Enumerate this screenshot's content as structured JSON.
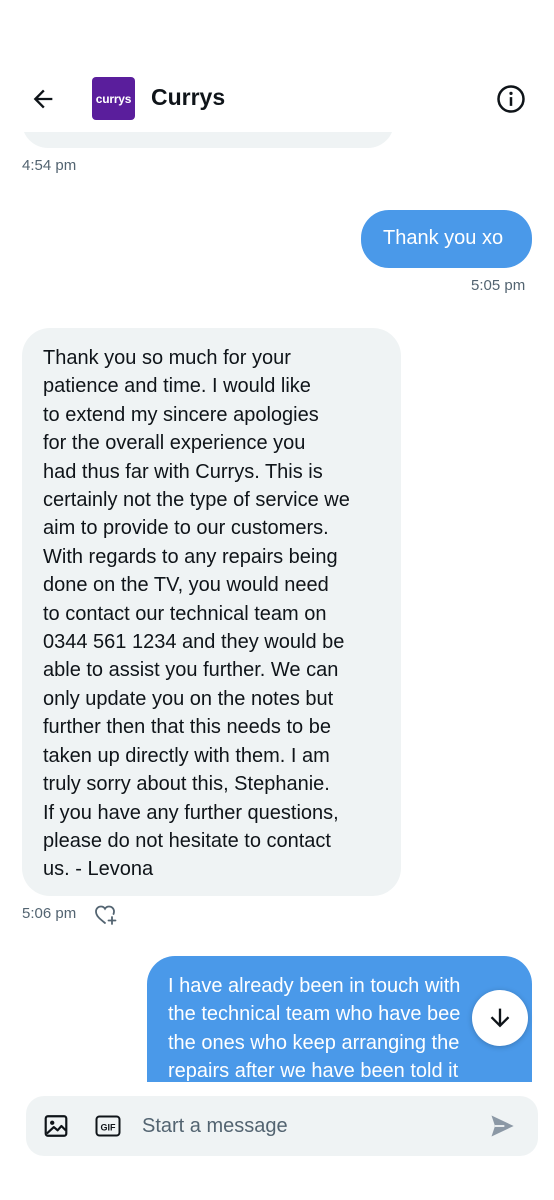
{
  "header": {
    "back_icon": "arrow-left-icon",
    "logo_text": "currys",
    "contact_name": "Currys",
    "info_icon": "info-icon",
    "brand_color": "#5a1e9c"
  },
  "messages": [
    {
      "id": "prev",
      "timestamp": "4:54 pm"
    },
    {
      "id": "m1",
      "direction": "outgoing",
      "lines": [
        "Thank you xo"
      ],
      "timestamp": "5:05 pm"
    },
    {
      "id": "m2",
      "direction": "incoming",
      "lines": [
        "Thank you so much for your",
        "patience and time. I would like",
        "to extend my sincere apologies",
        "for the overall experience you",
        "had thus far with Currys. This is",
        "certainly not the type of service we",
        "aim to provide to our customers.",
        "With regards to any repairs being",
        "done on the TV, you would need",
        "to contact our technical team on",
        "0344 561 1234 and they would be",
        "able to assist you further. We can",
        "only update you on the notes but",
        "further then that this needs to be",
        "taken up directly with them. I am",
        "truly sorry about this, Stephanie.",
        "If you have any further questions,",
        "please do not hesitate to contact",
        "us. - Levona"
      ],
      "timestamp": "5:06 pm",
      "react_icon": "heart-plus-icon"
    },
    {
      "id": "m3",
      "direction": "outgoing",
      "lines": [
        "I have already been in touch with",
        "the technical team who have bee",
        "the ones who keep arranging the",
        "repairs after we have been told it"
      ]
    }
  ],
  "scroll_down_icon": "arrow-down-icon",
  "composer": {
    "image_icon": "image-icon",
    "gif_label": "GIF",
    "placeholder": "Start a message",
    "send_icon": "send-icon"
  },
  "colors": {
    "outgoing_bubble": "#4a99e9",
    "incoming_bubble": "#eff3f4",
    "secondary_text": "#536471"
  }
}
